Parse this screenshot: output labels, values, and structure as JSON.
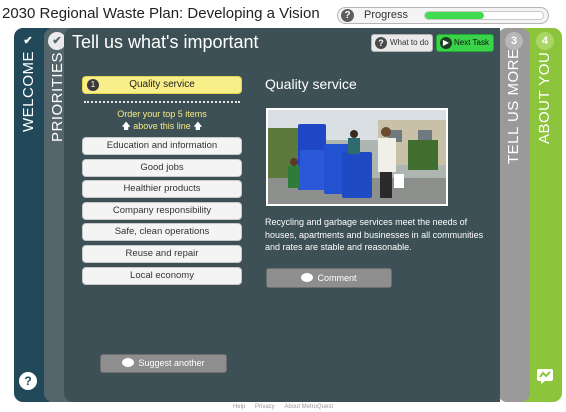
{
  "header": {
    "title": "2030 Regional Waste Plan: Developing a Vision",
    "progress_help": "?",
    "progress_label": "Progress",
    "progress_fraction": 0.5
  },
  "tabs": {
    "welcome": {
      "label": "WELCOME",
      "check": "✔",
      "help": "?"
    },
    "priorities": {
      "label": "PRIORITIES",
      "check": "✔"
    },
    "tell_more": {
      "label": "TELL US MORE",
      "number": "3"
    },
    "about_you": {
      "label": "ABOUT YOU",
      "number": "4"
    }
  },
  "main": {
    "title": "Tell us what's important",
    "what_to_do": "What to do",
    "what_to_do_icon": "?",
    "next_task": "Next Task",
    "next_icon": "▶"
  },
  "priorities": {
    "selected": {
      "rank": "1",
      "label": "Quality service"
    },
    "order_hint_line1": "Order your top 5 items",
    "order_hint_line2": "above this line",
    "arrow": "🡅",
    "items": [
      "Education and information",
      "Good jobs",
      "Healthier products",
      "Company responsibility",
      "Safe, clean operations",
      "Reuse and repair",
      "Local economy"
    ],
    "suggest_label": "Suggest another"
  },
  "detail": {
    "title": "Quality service",
    "description": "Recycling and garbage services meet the needs of houses, apartments and businesses in all communities and rates are stable and reasonable.",
    "comment_label": "Comment"
  },
  "footer": {
    "links": [
      "Help",
      "Privacy",
      "About MetroQuest"
    ]
  },
  "colors": {
    "welcome": "#21495a",
    "priorities": "#54666b",
    "main": "#3d5055",
    "tell_more": "#9a9a9a",
    "about_you": "#8cc43b",
    "selected": "#f8ee8a",
    "next_task": "#39d44a",
    "progress": "#3fdc4f"
  },
  "icons": {
    "help": "help-icon",
    "check": "check-icon",
    "next": "next-arrow-icon",
    "speech": "speech-bubble-icon",
    "arrow_up": "arrow-up-icon",
    "chat_bottom": "chat-icon"
  }
}
